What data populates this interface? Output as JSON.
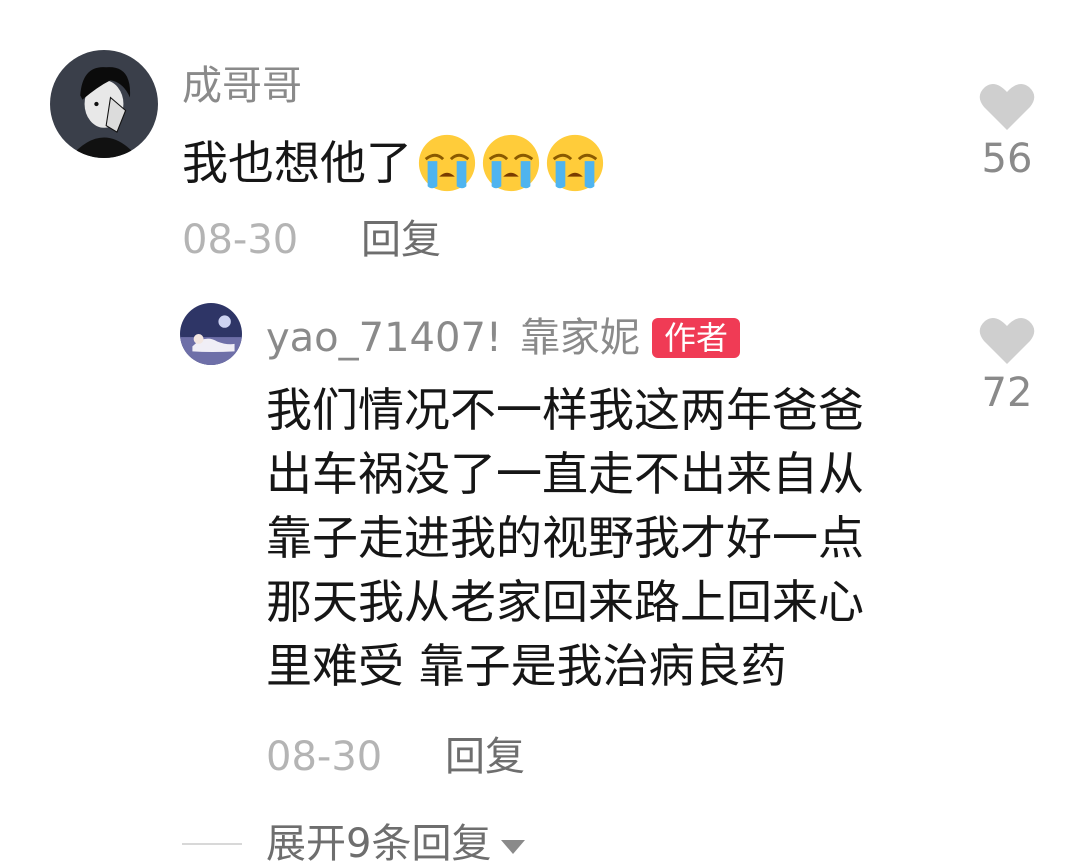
{
  "comments": [
    {
      "username": "成哥哥",
      "text": "我也想他了",
      "emoji": "crying-face-icon",
      "date": "08-30",
      "reply_label": "回复",
      "likes": "56"
    }
  ],
  "reply": {
    "username": "yao_71407!",
    "nickname": "靠家妮",
    "badge": "作者",
    "text_lines": [
      "我们情况不一样我这两年爸爸",
      "出车祸没了一直走不出来自从",
      "靠子走进我的视野我才好一点",
      "那天我从老家回来路上回来心",
      "里难受 靠子是我治病良药"
    ],
    "date": "08-30",
    "reply_label": "回复",
    "likes": "72"
  },
  "expand_label": "展开9条回复",
  "colors": {
    "badge": "#f03b55",
    "muted": "#8a8a8a",
    "date": "#b4b4b4",
    "heart": "#cfcfcf"
  }
}
